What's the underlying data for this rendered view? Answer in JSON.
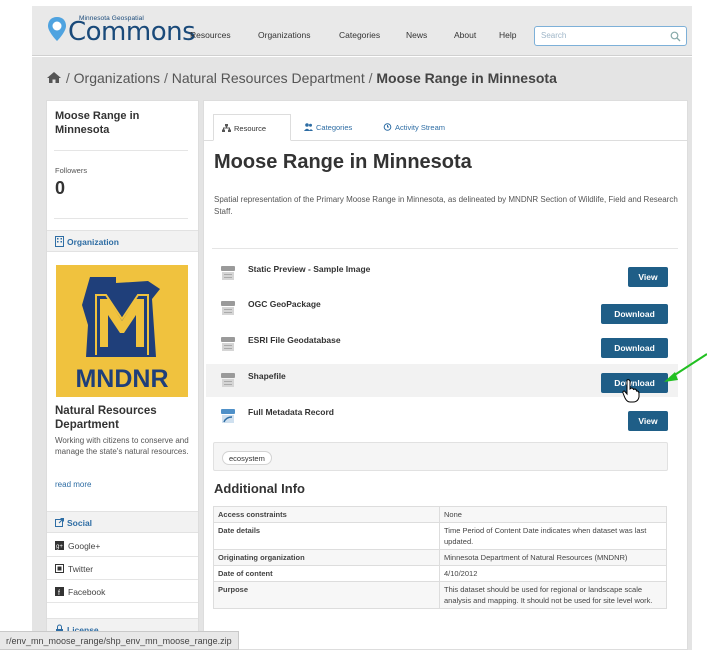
{
  "header": {
    "logo_small": "Minnesota Geospatial",
    "logo_big": "Commons",
    "nav": [
      "Resources",
      "Organizations",
      "Categories",
      "News",
      "About",
      "Help"
    ],
    "search_placeholder": "Search"
  },
  "breadcrumb": {
    "items": [
      "Organizations",
      "Natural Resources Department"
    ],
    "current": "Moose Range in Minnesota"
  },
  "sidebar": {
    "title": "Moose Range in Minnesota",
    "followers_label": "Followers",
    "followers_count": "0",
    "organization_heading": "Organization",
    "logo_text": "MNDNR",
    "org_name": "Natural Resources Department",
    "org_desc": "Working with citizens to conserve and manage the state's natural resources.",
    "read_more": "read more",
    "social_heading": "Social",
    "social": [
      "Google+",
      "Twitter",
      "Facebook"
    ],
    "license_heading": "License"
  },
  "tabs": [
    "Resource",
    "Categories",
    "Activity Stream"
  ],
  "dataset": {
    "title": "Moose Range in Minnesota",
    "description": "Spatial representation of the Primary Moose Range in Minnesota, as delineated by MNDNR Section of Wildlife, Field and Research Staff."
  },
  "resources": [
    {
      "name": "Static Preview - Sample Image",
      "button": "View"
    },
    {
      "name": "OGC GeoPackage",
      "button": "Download"
    },
    {
      "name": "ESRI File Geodatabase",
      "button": "Download"
    },
    {
      "name": "Shapefile",
      "button": "Download"
    },
    {
      "name": "Full Metadata Record",
      "button": "View"
    }
  ],
  "tags": [
    "ecosystem"
  ],
  "additional_info": {
    "title": "Additional Info",
    "rows": [
      {
        "key": "Access constraints",
        "value": "None"
      },
      {
        "key": "Date details",
        "value": "Time Period of Content Date indicates when dataset was last updated."
      },
      {
        "key": "Originating organization",
        "value": "Minnesota Department of Natural Resources (MNDNR)"
      },
      {
        "key": "Date of content",
        "value": "4/10/2012"
      },
      {
        "key": "Purpose",
        "value": "This dataset should be used for regional or landscape scale analysis and mapping. It should not be used for site level work."
      }
    ]
  },
  "status_url": "r/env_mn_moose_range/shp_env_mn_moose_range.zip",
  "colors": {
    "accent": "#1f5e87",
    "link": "#2e6da4",
    "logo_bg": "#f0c23e",
    "annotation_arrow": "#22c022"
  }
}
